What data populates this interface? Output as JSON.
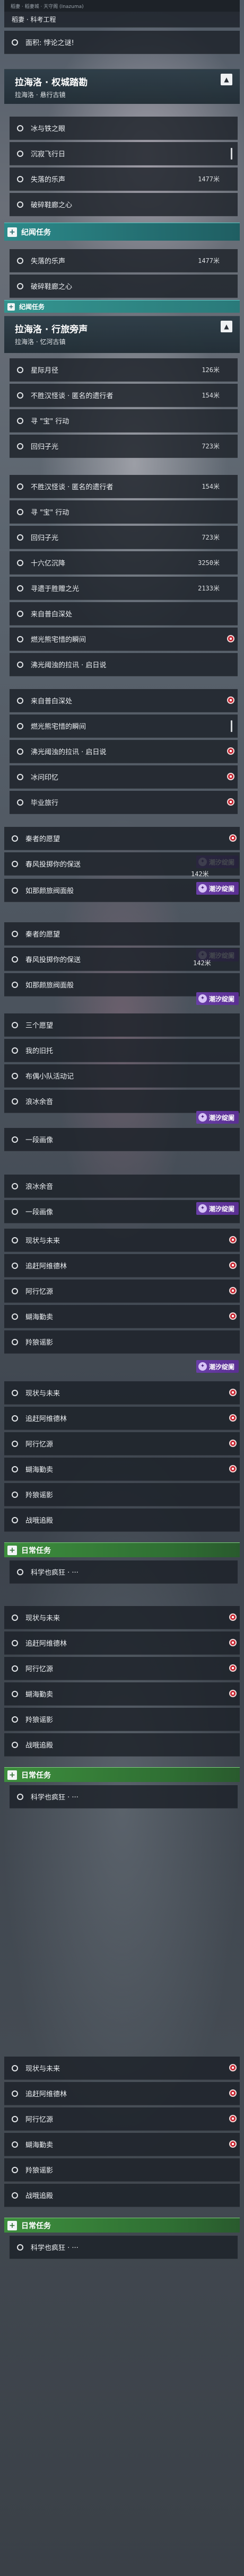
{
  "top": {
    "crumb": "稻妻 · 稻妻城 · 天守阁 (Inazuma)",
    "quest_sub": "稻妻 · 科考工程"
  },
  "labels": {
    "world_quest_header": "纪闻任务",
    "daily_header": "日常任务",
    "quest1_title": "拉海洛 · 权城踏勘",
    "quest1_sub": "拉海洛 · 悬行古镜",
    "quest2_title": "拉海洛 · 行旅旁声",
    "quest2_sub": "拉海洛 · 忆河古镇",
    "event_badge": "潮汐绽阑",
    "val_142": "142米"
  },
  "rows": [
    {
      "name": "面积: 悖论之谜!",
      "val": ""
    },
    {
      "name": "冰与铁之眼",
      "val": ""
    },
    {
      "name": "沉寂飞行日",
      "val": ""
    },
    {
      "name": "失落的乐声",
      "val": "1477米"
    },
    {
      "name": "破碎鞋廊之心",
      "val": ""
    },
    {
      "name": "失落的乐声",
      "val": "1477米"
    },
    {
      "name": "破碎鞋廊之心",
      "val": ""
    },
    {
      "name": "星际月径",
      "val": "126米"
    },
    {
      "name": "不胜汉怪谈 · 匿名的遗行者",
      "val": "154米"
    },
    {
      "name": "寻 \"宝\" 行动",
      "val": ""
    },
    {
      "name": "回归子光",
      "val": "723米"
    },
    {
      "name": "不胜汉怪谈 · 匿名的遗行者",
      "val": "154米"
    },
    {
      "name": "寻 \"宝\" 行动",
      "val": ""
    },
    {
      "name": "回归子光",
      "val": "723米"
    },
    {
      "name": "十六亿沉降",
      "val": "3250米"
    },
    {
      "name": "寻遗于胜赠之光",
      "val": "2133米"
    },
    {
      "name": "来自普白深处",
      "val": ""
    },
    {
      "name": "燃光熊宅惜的瞬间",
      "val": ""
    },
    {
      "name": "沸光阈浊的拉讯 · 启日说",
      "val": ""
    },
    {
      "name": "来自普白深处",
      "val": ""
    },
    {
      "name": "燃光熊宅惜的瞬间",
      "val": ""
    },
    {
      "name": "沸光阈浊的拉讯 · 启日说",
      "val": ""
    },
    {
      "name": "冰问印忆",
      "val": ""
    },
    {
      "name": "毕业旅行",
      "val": ""
    },
    {
      "name": "秦者的愿望",
      "val": ""
    },
    {
      "name": "春风投掷你的保送",
      "val": "142米"
    },
    {
      "name": "如那颜旅阀面般",
      "val": ""
    },
    {
      "name": "秦者的愿望",
      "val": ""
    },
    {
      "name": "春风投掷你的保送",
      "val": ""
    },
    {
      "name": "如那颜旅阀面般",
      "val": ""
    },
    {
      "name": "三个愿望",
      "val": ""
    },
    {
      "name": "我的旧托",
      "val": ""
    },
    {
      "name": "布偶小队活动记",
      "val": ""
    },
    {
      "name": "浪冰余音",
      "val": ""
    },
    {
      "name": "一段画像",
      "val": ""
    },
    {
      "name": "浪冰余音",
      "val": ""
    },
    {
      "name": "一段画像",
      "val": ""
    },
    {
      "name": "现状与未来",
      "val": ""
    },
    {
      "name": "追赶阿维德林",
      "val": ""
    },
    {
      "name": "阿行忆源",
      "val": ""
    },
    {
      "name": "蝴海勤卖",
      "val": ""
    },
    {
      "name": "羚狼谣影",
      "val": ""
    },
    {
      "name": "现状与未来",
      "val": ""
    },
    {
      "name": "追赶阿维德林",
      "val": ""
    },
    {
      "name": "阿行忆源",
      "val": ""
    },
    {
      "name": "蝴海勤卖",
      "val": ""
    },
    {
      "name": "羚狼谣影",
      "val": ""
    },
    {
      "name": "战哦追殿",
      "val": ""
    },
    {
      "name": "科学也疯狂 · ···",
      "val": ""
    },
    {
      "name": "现状与未来",
      "val": ""
    },
    {
      "name": "追赶阿维德林",
      "val": ""
    },
    {
      "name": "阿行忆源",
      "val": ""
    },
    {
      "name": "蝴海勤卖",
      "val": ""
    },
    {
      "name": "羚狼谣影",
      "val": ""
    },
    {
      "name": "战哦追殿",
      "val": ""
    },
    {
      "name": "科学也疯狂 · ···",
      "val": ""
    },
    {
      "name": "现状与未来",
      "val": ""
    },
    {
      "name": "追赶阿维德林",
      "val": ""
    },
    {
      "name": "阿行忆源",
      "val": ""
    },
    {
      "name": "蝴海勤卖",
      "val": ""
    },
    {
      "name": "羚狼谣影",
      "val": ""
    },
    {
      "name": "战哦追殿",
      "val": ""
    },
    {
      "name": "科学也疯狂 · ···",
      "val": ""
    }
  ]
}
